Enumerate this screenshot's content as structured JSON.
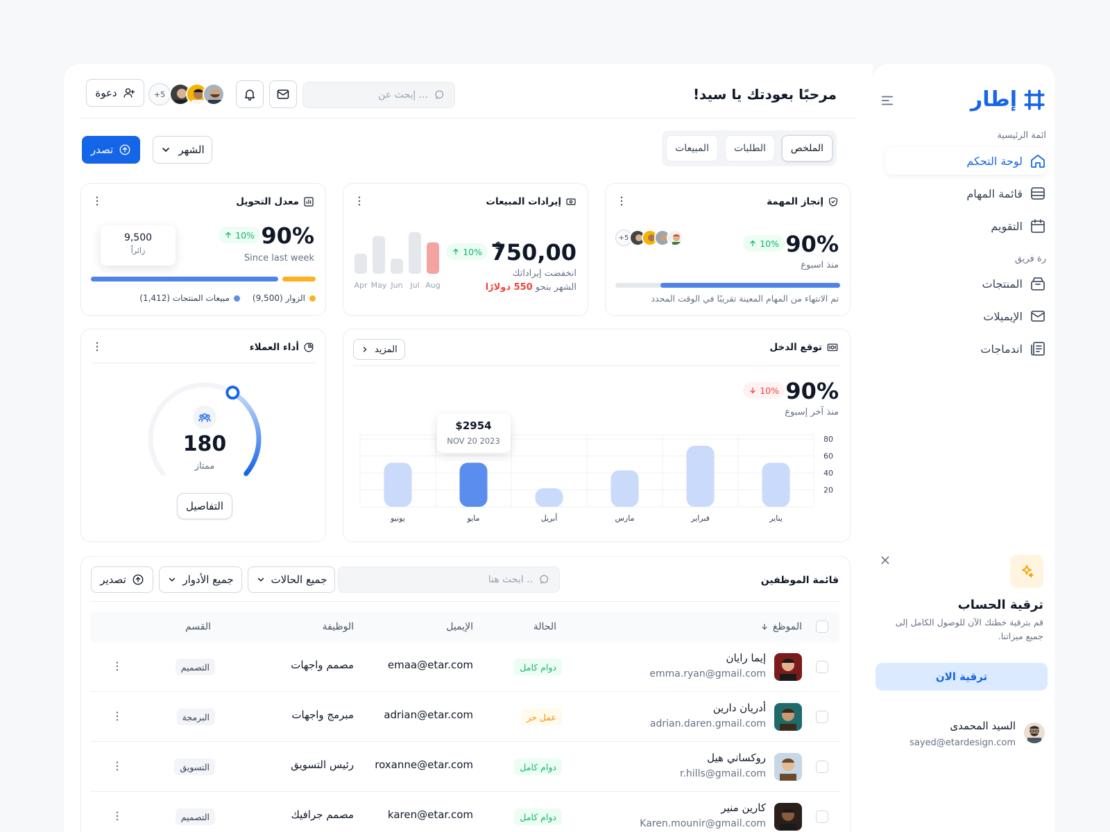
{
  "brand": {
    "name": "إطار",
    "color": "#1565e8"
  },
  "sidebar": {
    "main_label": "ائمة الرئيسية",
    "main_items": [
      {
        "label": "لوحة التحكم",
        "icon": "home-icon",
        "active": true
      },
      {
        "label": "قائمة المهام",
        "icon": "stack-icon",
        "active": false
      },
      {
        "label": "التقويم",
        "icon": "calendar-icon",
        "active": false
      }
    ],
    "team_label": "رة فريق",
    "team_items": [
      {
        "label": "المنتجات",
        "icon": "box-icon"
      },
      {
        "label": "الإيميلات",
        "icon": "mail-icon"
      },
      {
        "label": "اندماجات",
        "icon": "integrations-icon"
      }
    ]
  },
  "upgrade": {
    "title": "ترقية الحساب",
    "description": "قم بترقية خطتك الآن للوصول الكامل إلى جميع ميزاتنا.",
    "button": "ترقية الان"
  },
  "user": {
    "name": "السيد المحمدى",
    "email": "sayed@etardesign.com"
  },
  "header": {
    "greeting": "مرحبًا بعودتك يا سيد!",
    "search_placeholder": "إبحث عن ...",
    "avatars_more": "+5",
    "invite": "دعوة"
  },
  "tabs": [
    "الملخص",
    "الطلبات",
    "المبيعات"
  ],
  "period": "الشهر",
  "export": "تصدر",
  "task_card": {
    "title": "إنجاز المهمة",
    "value": "90%",
    "change": "10%",
    "since": "منذ اسبوع",
    "avatars_more": "+5",
    "progress": 0.8,
    "note": "تم الانتهاء من المهام المعينة تقريبًا في الوقت المحدد"
  },
  "revenue_card": {
    "title": "إيرادات المبيعات",
    "currency": "$",
    "value": "750,00",
    "change": "10%",
    "note1": "انخفضت إيراداتك",
    "note2_prefix": "الشهر بنحو",
    "note2_amount": "550 دولارًا",
    "mini_chart": {
      "months": [
        "Apr",
        "May",
        "Jun",
        "Jul",
        "Aug"
      ],
      "values": [
        32,
        60,
        24,
        66,
        50
      ],
      "highlight_index": 4
    }
  },
  "conversion_card": {
    "title": "معدل التحويل",
    "value": "90%",
    "change": "10%",
    "since": "Since last week",
    "tooltip_value": "9,500",
    "tooltip_label": "زائراً",
    "bar_blue_share": 0.85,
    "legend": [
      {
        "label": "الزوار (9,500)",
        "color": "#fdb022"
      },
      {
        "label": "مبيعات المنتجات (1,412)",
        "color": "#5b8def"
      }
    ]
  },
  "income_card": {
    "title": "توقع الدخل",
    "more": "المزيد",
    "value": "90%",
    "change": "10%",
    "since": "منذ آخر إسبوع",
    "tooltip_value": "$2954",
    "tooltip_date": "NOV 20 2023"
  },
  "chart_data": {
    "type": "bar",
    "categories": [
      "يناير",
      "فبراير",
      "مارس",
      "أبريل",
      "مايو",
      "يونيو"
    ],
    "values": [
      52,
      72,
      43,
      22,
      52,
      52
    ],
    "highlight_index": 4,
    "y_ticks": [
      "80",
      "60",
      "40",
      "20"
    ],
    "ylim": [
      0,
      85
    ]
  },
  "customer_card": {
    "title": "أداء العملاء",
    "value": "180",
    "label": "ممتاز",
    "button": "التفاصيل",
    "gauge_fraction": 0.38
  },
  "employees": {
    "title": "قائمة الموظفين",
    "search_placeholder": "ابحث هنا ..",
    "filter_status": "جميع الحالات",
    "filter_roles": "جميع الأدوار",
    "export": "تصدير",
    "columns": {
      "employee": "الموظغ",
      "status": "الحالة",
      "email": "الإيميل",
      "job": "الوظيفة",
      "dept": "القسم"
    },
    "rows": [
      {
        "name": "إيما رايان",
        "personal": "emma.ryan@gmail.com",
        "status": "دوام كامل",
        "status_type": "full",
        "email": "emaa@etar.com",
        "job": "مصمم واجهات",
        "dept": "التصميم"
      },
      {
        "name": "أدريان دارين",
        "personal": "adrian.daren.gmail.com",
        "status": "عمل حر",
        "status_type": "free",
        "email": "adrian@etar.com",
        "job": "مبرمج واجهات",
        "dept": "البرمجة"
      },
      {
        "name": "روكساني هيل",
        "personal": "r.hills@gmail.com",
        "status": "دوام كامل",
        "status_type": "full",
        "email": "roxanne@etar.com",
        "job": "رئيس التسويق",
        "dept": "التسويق"
      },
      {
        "name": "كارين منير",
        "personal": "Karen.mounir@gmail.com",
        "status": "دوام كامل",
        "status_type": "full",
        "email": "karen@etar.com",
        "job": "مصمم جرافيك",
        "dept": "التصميم"
      }
    ]
  }
}
